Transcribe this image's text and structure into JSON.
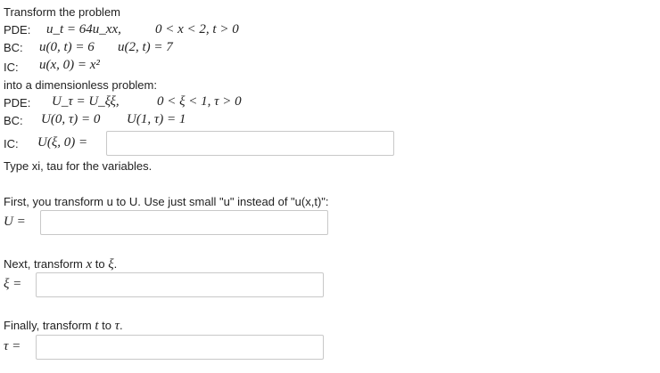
{
  "intro": "Transform the problem",
  "problem": {
    "pde_label": "PDE:",
    "pde_eq": "u_t = 64u_xx,",
    "pde_domain": "0 < x < 2,   t > 0",
    "bc_label": "BC:",
    "bc_left": "u(0, t) = 6",
    "bc_right": "u(2, t) = 7",
    "ic_label": "IC:",
    "ic_eq": "u(x, 0) = x²"
  },
  "into": "into a dimensionless problem:",
  "target": {
    "pde_label": "PDE:",
    "pde_eq": "U_τ = U_ξξ,",
    "pde_domain": "0 < ξ < 1,   τ > 0",
    "bc_label": "BC:",
    "bc_left": "U(0, τ) = 0",
    "bc_right": "U(1, τ) = 1",
    "ic_label": "IC:",
    "ic_eq": "U(ξ, 0) ="
  },
  "hint": "Type xi, tau for the variables.",
  "step1": {
    "text": "First, you transform u to U. Use just small \"u\" instead of \"u(x,t)\":",
    "lhs": "U ="
  },
  "step2": {
    "text_before": "Next, transform ",
    "var": "x",
    "text_mid": " to ",
    "var2": "ξ",
    "text_after": ".",
    "lhs": "ξ ="
  },
  "step3": {
    "text_before": "Finally, transform ",
    "var": "t",
    "text_mid": " to ",
    "var2": "τ",
    "text_after": ".",
    "lhs": "τ ="
  },
  "inputs": {
    "ic_value": "",
    "U_value": "",
    "xi_value": "",
    "tau_value": ""
  }
}
